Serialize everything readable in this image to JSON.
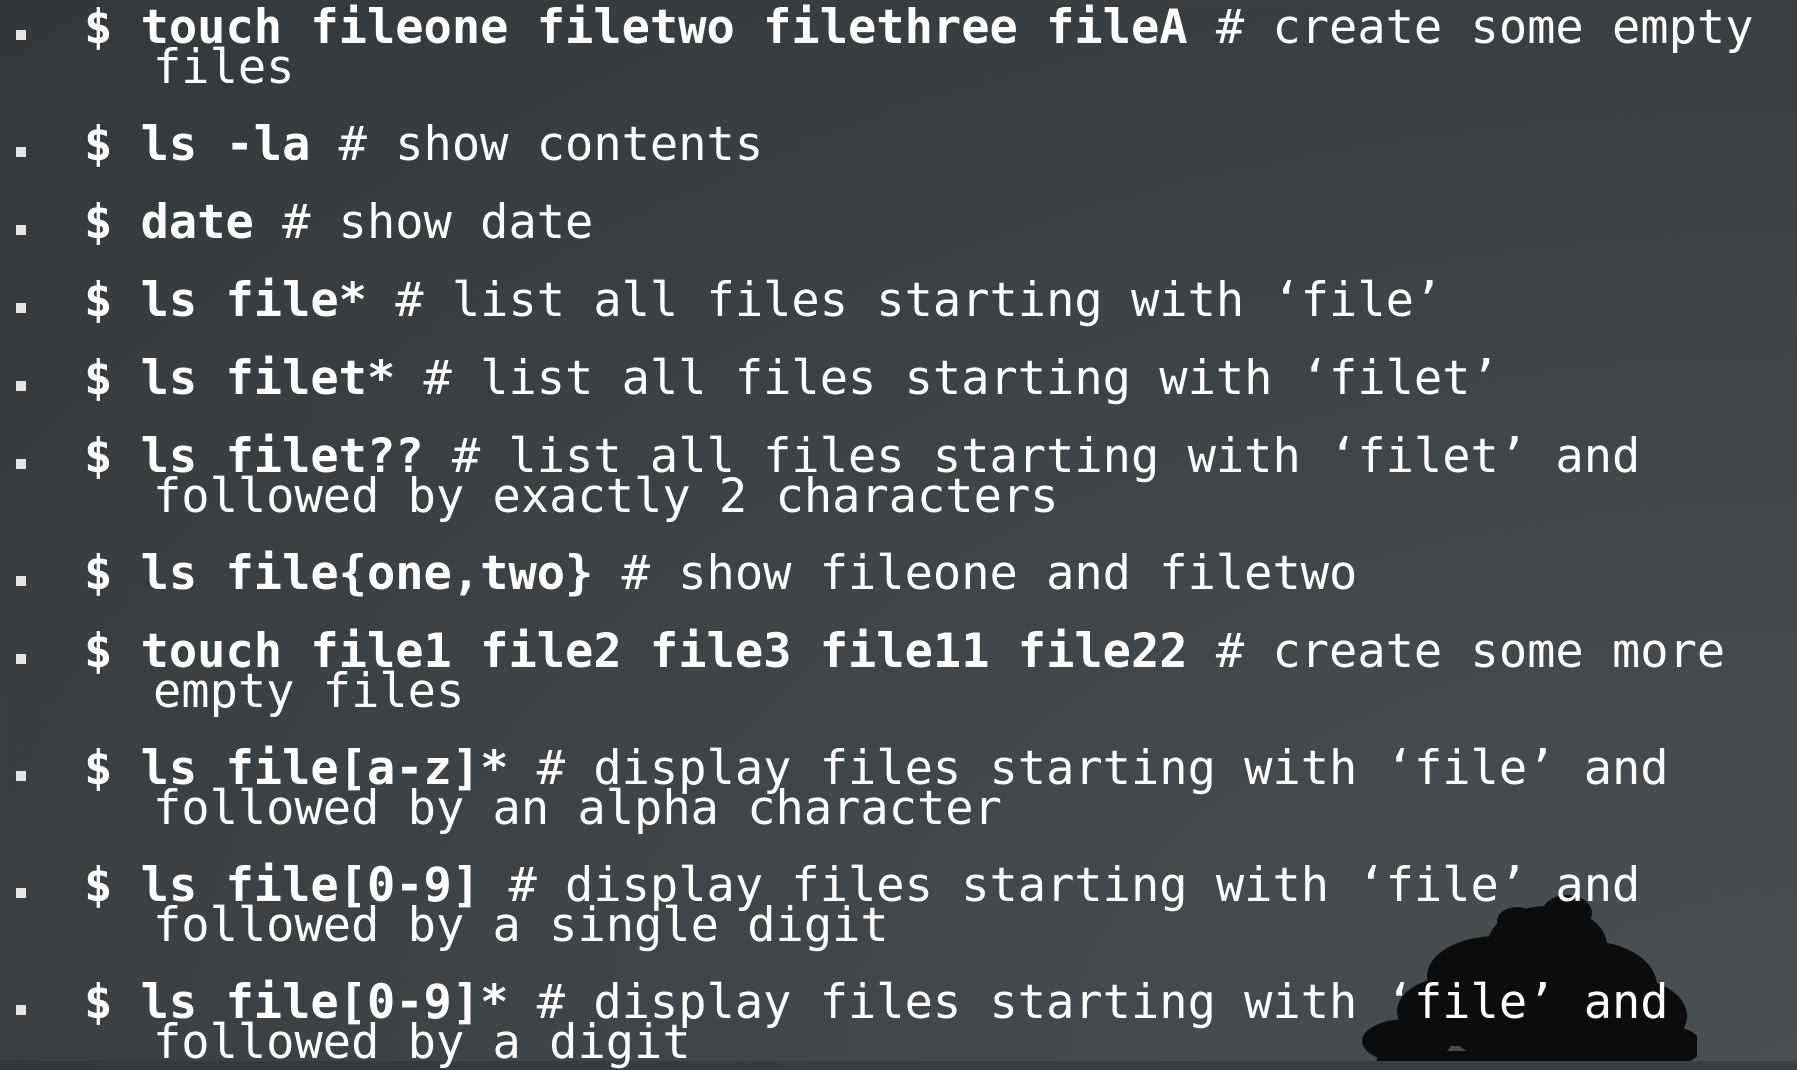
{
  "slide": {
    "items": [
      {
        "cmd": "$ touch fileone filetwo filethree fileA",
        "comment": " # create some empty",
        "cont": "files"
      },
      {
        "cmd": "$ ls -la",
        "comment": " # show contents",
        "cont": ""
      },
      {
        "cmd": "$ date",
        "comment": " # show date",
        "cont": ""
      },
      {
        "cmd": "$ ls file*",
        "comment": " # list all files starting with ‘file’",
        "cont": ""
      },
      {
        "cmd": "$ ls filet*",
        "comment": " # list all files starting with ‘filet’",
        "cont": ""
      },
      {
        "cmd": "$ ls filet??",
        "comment": " # list all files starting with ‘filet’ and",
        "cont": "followed by exactly 2 characters"
      },
      {
        "cmd": "$ ls file{one,two}",
        "comment": " # show fileone and filetwo",
        "cont": ""
      },
      {
        "cmd": "$ touch file1 file2 file3 file11 file22",
        "comment": " # create some more",
        "cont": "empty files"
      },
      {
        "cmd": "$ ls file[a-z]*",
        "comment": " # display files starting with ‘file’ and",
        "cont": "followed by an alpha character"
      },
      {
        "cmd": "$ ls file[0-9]",
        "comment": " # display files starting with ‘file’ and",
        "cont": "followed by a single digit"
      },
      {
        "cmd": "$ ls file[0-9]*",
        "comment": " # display files starting with ‘file’ and",
        "cont": "followed by a digit"
      }
    ]
  },
  "colors": {
    "text": "#ffffff",
    "background": "#3f4548",
    "bullet": "#e6e6e6",
    "tree": "#0a0c0d"
  },
  "icons": {
    "bullet": "square-bullet-icon",
    "decoration": "tree-silhouette-icon"
  }
}
